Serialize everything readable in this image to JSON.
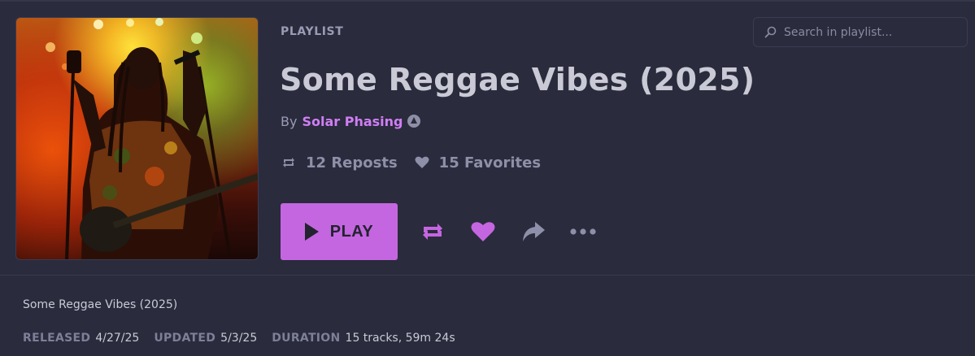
{
  "header": {
    "eyebrow": "PLAYLIST",
    "title": "Some Reggae Vibes (2025)",
    "by_label": "By",
    "artist": "Solar Phasing"
  },
  "stats": {
    "reposts": "12 Reposts",
    "favorites": "15 Favorites"
  },
  "actions": {
    "play_label": "PLAY",
    "icons": [
      "repost-icon",
      "heart-icon",
      "share-icon",
      "more-icon"
    ]
  },
  "search": {
    "placeholder": "Search in playlist..."
  },
  "details": {
    "description": "Some Reggae Vibes (2025)",
    "released_label": "RELEASED",
    "released": "4/27/25",
    "updated_label": "UPDATED",
    "updated": "5/3/25",
    "duration_label": "DURATION",
    "duration": "15 tracks, 59m 24s"
  },
  "colors": {
    "background": "#2a2b3c",
    "accent": "#c466e0",
    "artist_link": "#d07ef5",
    "muted": "#8e8fa8"
  }
}
